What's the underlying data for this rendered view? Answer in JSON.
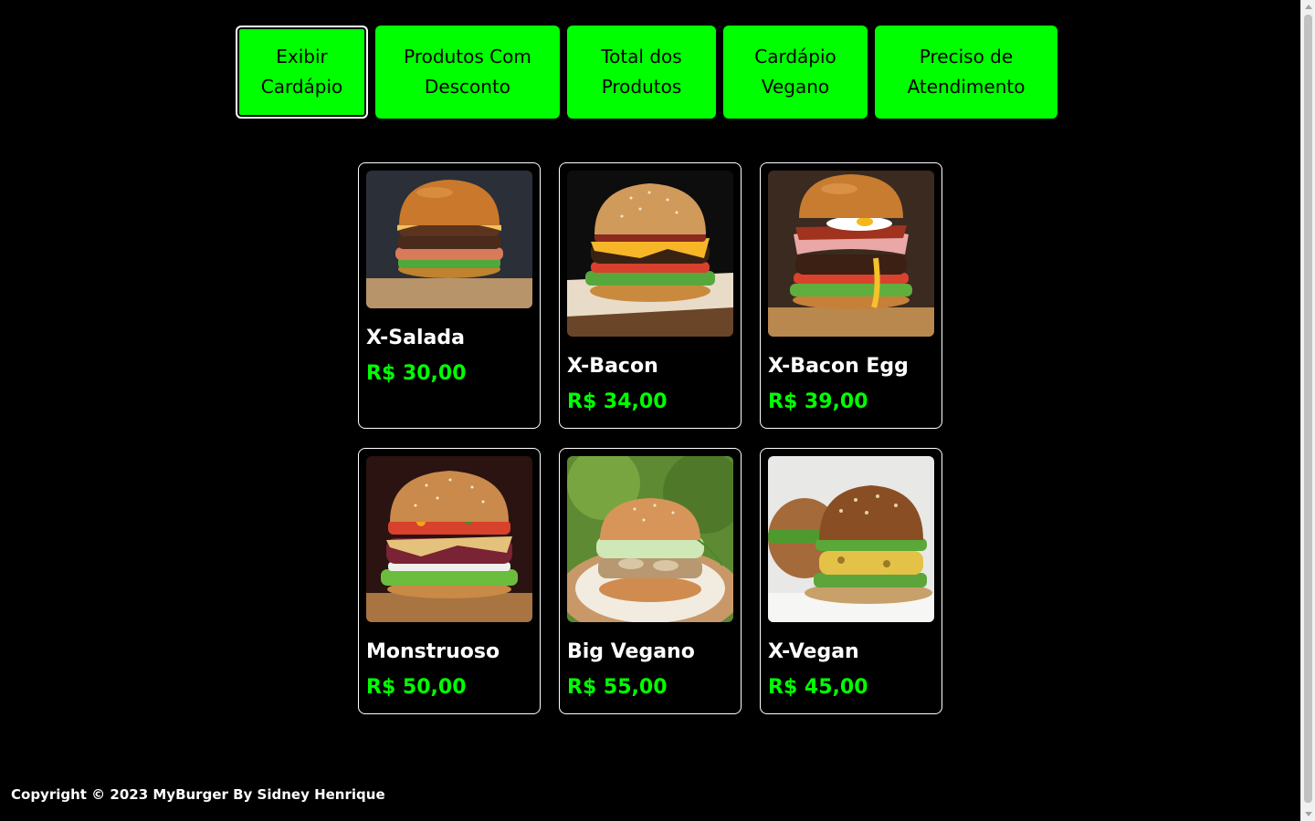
{
  "nav": {
    "buttons": [
      {
        "label": "Exibir\nCardápio",
        "active": true
      },
      {
        "label": "Produtos Com\nDesconto",
        "active": false
      },
      {
        "label": "Total dos\nProdutos",
        "active": false
      },
      {
        "label": "Cardápio\nVegano",
        "active": false
      },
      {
        "label": "Preciso de\nAtendimento",
        "active": false
      }
    ]
  },
  "products": [
    {
      "name": "X-Salada",
      "price": "R$ 30,00",
      "image": "burger-photo"
    },
    {
      "name": "X-Bacon",
      "price": "R$ 34,00",
      "image": "burger-photo"
    },
    {
      "name": "X-Bacon Egg",
      "price": "R$ 39,00",
      "image": "burger-photo"
    },
    {
      "name": "Monstruoso",
      "price": "R$ 50,00",
      "image": "burger-photo"
    },
    {
      "name": "Big Vegano",
      "price": "R$ 55,00",
      "image": "burger-photo"
    },
    {
      "name": "X-Vegan",
      "price": "R$ 45,00",
      "image": "burger-photo"
    }
  ],
  "footer": {
    "text": "Copyright © 2023 MyBurger By Sidney Henrique"
  },
  "colors": {
    "accent": "#00ff00",
    "background": "#000000",
    "text": "#ffffff"
  }
}
